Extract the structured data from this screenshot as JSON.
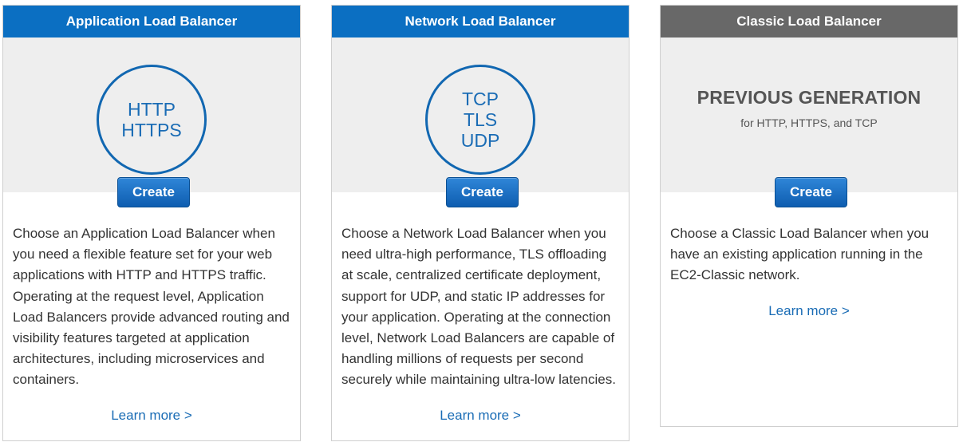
{
  "cards": [
    {
      "title": "Application Load Balancer",
      "protocols": [
        "HTTP",
        "HTTPS"
      ],
      "create_label": "Create",
      "description": "Choose an Application Load Balancer when you need a flexible feature set for your web applications with HTTP and HTTPS traffic. Operating at the request level, Application Load Balancers provide advanced routing and visibility features targeted at application architectures, including microservices and containers.",
      "learn_more": "Learn more >"
    },
    {
      "title": "Network Load Balancer",
      "protocols": [
        "TCP",
        "TLS",
        "UDP"
      ],
      "create_label": "Create",
      "description": "Choose a Network Load Balancer when you need ultra-high performance, TLS offloading at scale, centralized certificate deployment, support for UDP, and static IP addresses for your application. Operating at the connection level, Network Load Balancers are capable of handling millions of requests per second securely while maintaining ultra-low latencies.",
      "learn_more": "Learn more >"
    },
    {
      "title": "Classic Load Balancer",
      "generation_title": "PREVIOUS GENERATION",
      "generation_subtitle": "for HTTP, HTTPS, and TCP",
      "create_label": "Create",
      "description": "Choose a Classic Load Balancer when you have an existing application running in the EC2-Classic network.",
      "learn_more": "Learn more >"
    }
  ],
  "colors": {
    "header_blue": "#0b6fc2",
    "header_gray": "#686868",
    "link_blue": "#1a6cb5",
    "panel_gray": "#eeeeee"
  }
}
